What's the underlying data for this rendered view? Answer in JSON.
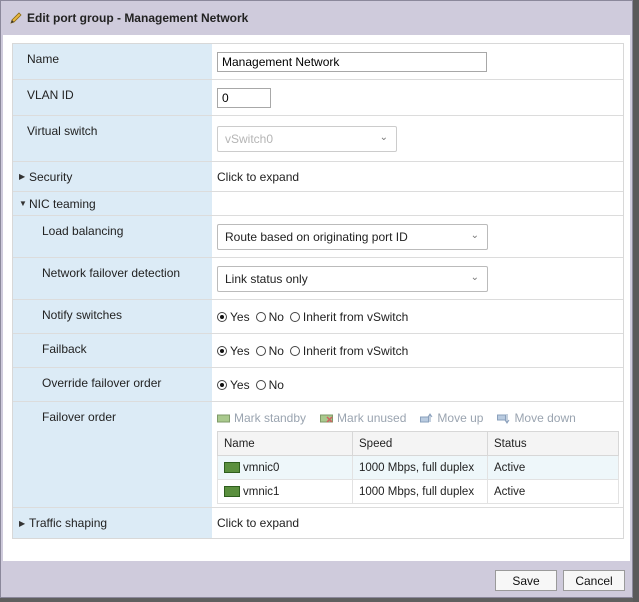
{
  "dialog": {
    "title": "Edit port group - Management Network",
    "title_icon": "pencil-icon"
  },
  "fields": {
    "name_label": "Name",
    "name_value": "Management Network",
    "vlan_label": "VLAN ID",
    "vlan_value": "0",
    "vswitch_label": "Virtual switch",
    "vswitch_value": "vSwitch0",
    "security_label": "Security",
    "security_value": "Click to expand",
    "nic_teaming_label": "NIC teaming",
    "load_balancing_label": "Load balancing",
    "load_balancing_value": "Route based on originating port ID",
    "failover_detection_label": "Network failover detection",
    "failover_detection_value": "Link status only",
    "notify_label": "Notify switches",
    "failback_label": "Failback",
    "override_label": "Override failover order",
    "failover_order_label": "Failover order",
    "traffic_label": "Traffic shaping",
    "traffic_value": "Click to expand"
  },
  "radios": {
    "yes": "Yes",
    "no": "No",
    "inherit": "Inherit from vSwitch"
  },
  "toolbar": {
    "mark_standby": "Mark standby",
    "mark_unused": "Mark unused",
    "move_up": "Move up",
    "move_down": "Move down"
  },
  "nic_table": {
    "headers": [
      "Name",
      "Speed",
      "Status"
    ],
    "rows": [
      {
        "name": "vmnic0",
        "speed": "1000 Mbps, full duplex",
        "status": "Active"
      },
      {
        "name": "vmnic1",
        "speed": "1000 Mbps, full duplex",
        "status": "Active"
      }
    ]
  },
  "buttons": {
    "save": "Save",
    "cancel": "Cancel"
  },
  "colors": {
    "label_bg": "#dcebf6",
    "dialog_bg": "#cfcbdc"
  }
}
